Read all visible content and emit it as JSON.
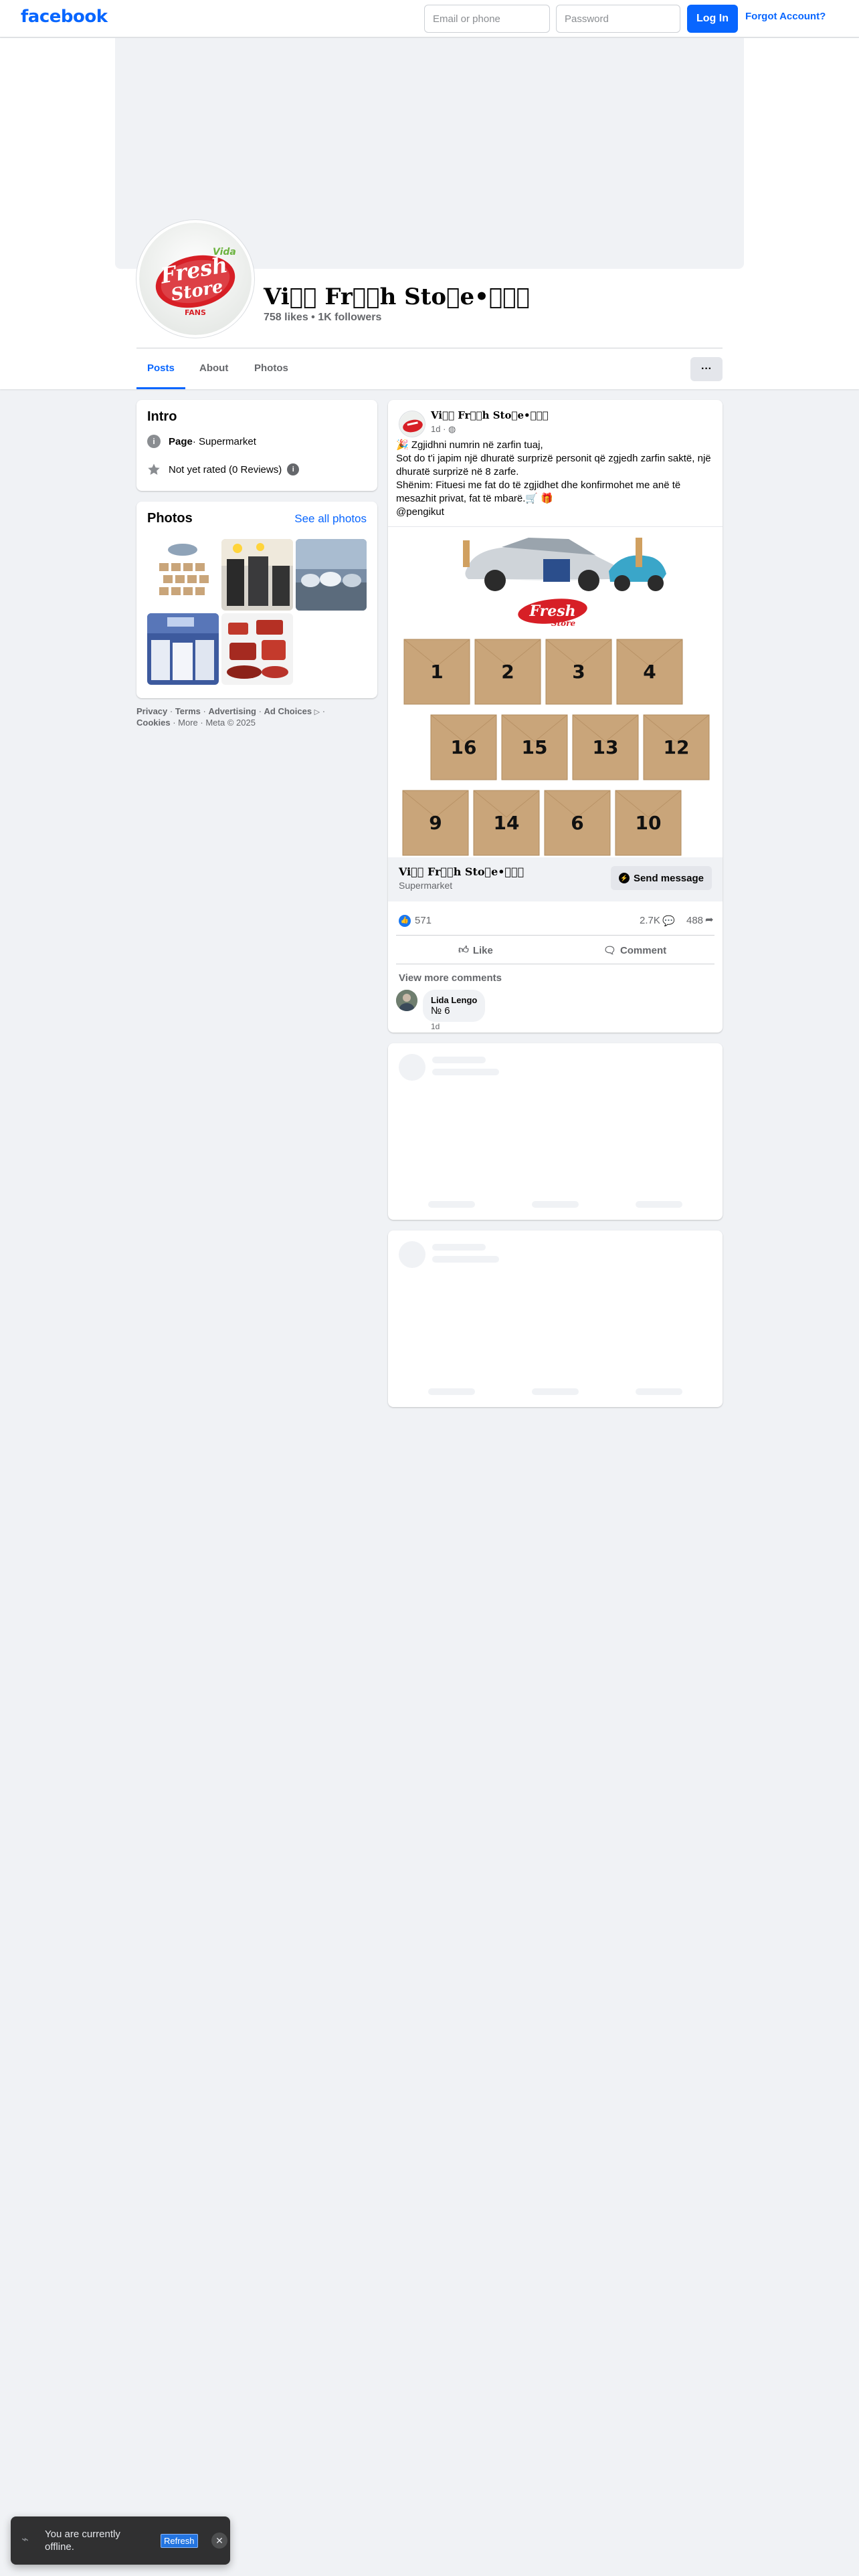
{
  "topbar": {
    "logo": "facebook",
    "email_placeholder": "Email or phone",
    "password_placeholder": "Password",
    "login_label": "Log In",
    "forgot_label": "Forgot Account?"
  },
  "page": {
    "name": "Vi⃝⃝ Fr⃝⃝h Sto⃝e•⃝⃝⃝",
    "stats": "758 likes • 1K followers",
    "avatar_texts": {
      "top": "Vida",
      "line1": "Fresh",
      "line2": "Store",
      "bottom": "FANS"
    }
  },
  "tabs": [
    "Posts",
    "About",
    "Photos"
  ],
  "more_label": "···",
  "intro": {
    "title": "Intro",
    "page_label": "Page",
    "category": " · Supermarket",
    "rating": "Not yet rated (0 Reviews)"
  },
  "photos": {
    "title": "Photos",
    "see_all": "See all photos"
  },
  "footer": {
    "privacy": "Privacy",
    "terms": "Terms",
    "advertising": "Advertising",
    "ad_choices": "Ad Choices",
    "cookies": "Cookies",
    "more": "More",
    "meta": "Meta © 2025",
    "sep": " · "
  },
  "post": {
    "author": "Vi⃝⃝ Fr⃝⃝h Sto⃝e•⃝⃝⃝",
    "time": "1d · ",
    "text_lines": [
      "🎉 Zgjidhni numrin në zarfin tuaj,",
      "Sot do t'i japim një dhuratë surprizë personit që zgjedh zarfin saktë, një dhuratë surprizë në 8 zarfe.",
      "Shënim: Fituesi me fat do të zgjidhet dhe konfirmohet me anë të mesazhit privat, fat të mbarë.🛒 🎁",
      "@pengikut"
    ],
    "envelopes_row1": [
      "1",
      "2",
      "3",
      "4"
    ],
    "envelopes_row2": [
      "16",
      "15",
      "13",
      "12"
    ],
    "envelopes_row3": [
      "9",
      "14",
      "6",
      "10"
    ],
    "promo_name": "Vi⃝⃝ Fr⃝⃝h Sto⃝e•⃝⃝⃝",
    "promo_category": "Supermarket",
    "send_label": "Send message",
    "reaction_count": "571",
    "comment_count": "2.7K",
    "share_count": "488",
    "like_label": "Like",
    "comment_label": "Comment",
    "view_more": "View more comments",
    "comment": {
      "author": "Lida Lengo",
      "text": "№ 6",
      "time": "1d"
    }
  },
  "toast": {
    "text": "You are currently offline.",
    "refresh": "Refresh",
    "close": "✕"
  },
  "colors": {
    "brand": "#0866ff",
    "fresh_red": "#d71f26",
    "fresh_green": "#6cb33f",
    "envelope": "#c9a57a"
  }
}
